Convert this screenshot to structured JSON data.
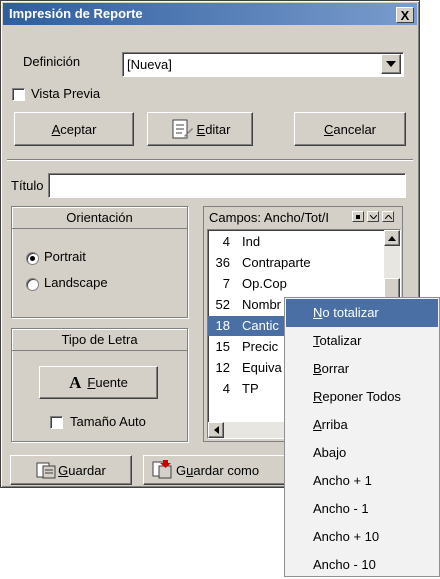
{
  "window": {
    "title": "Impresión de Reporte",
    "close_glyph": "X"
  },
  "definicion": {
    "label": "Definición",
    "value": "[Nueva]"
  },
  "vista_previa": {
    "label": "Vista Previa",
    "checked": false
  },
  "buttons": {
    "aceptar_u": "A",
    "aceptar_rest": "ceptar",
    "editar_u": "E",
    "editar_rest": "ditar",
    "cancelar_u": "C",
    "cancelar_rest": "ancelar",
    "guardar_u": "G",
    "guardar_rest": "uardar",
    "guardar_como_pre": "G",
    "guardar_como_u": "u",
    "guardar_como_rest": "ardar como"
  },
  "titulo": {
    "label": "Título",
    "value": ""
  },
  "orientacion": {
    "title": "Orientación",
    "options": [
      "Portrait",
      "Landscape"
    ],
    "selected": "Portrait"
  },
  "tipo_letra": {
    "title": "Tipo de Letra",
    "fuente_glyph": "A",
    "fuente_u": "F",
    "fuente_rest": "uente",
    "tamano_auto": "Tamaño Auto"
  },
  "campos": {
    "header": "Campos: Ancho/Tot/I",
    "rows": [
      {
        "num": "4",
        "name": "Ind"
      },
      {
        "num": "36",
        "name": "Contraparte"
      },
      {
        "num": "7",
        "name": "Op.Cop"
      },
      {
        "num": "52",
        "name": "Nombr"
      },
      {
        "num": "18",
        "name": "Cantic"
      },
      {
        "num": "15",
        "name": "Precic"
      },
      {
        "num": "12",
        "name": "Equiva"
      },
      {
        "num": "4",
        "name": "TP"
      }
    ],
    "selected_index": 4
  },
  "context_menu": {
    "items": [
      {
        "u": "N",
        "rest": "o totalizar"
      },
      {
        "u": "T",
        "rest": "otalizar"
      },
      {
        "u": "B",
        "rest": "orrar"
      },
      {
        "u": "R",
        "rest": "eponer Todos"
      },
      {
        "u": "A",
        "rest": "rriba"
      },
      {
        "u": "",
        "rest": "Abajo"
      },
      {
        "u": "",
        "rest": "Ancho + 1"
      },
      {
        "u": "",
        "rest": "Ancho - 1"
      },
      {
        "u": "",
        "rest": "Ancho + 10"
      },
      {
        "u": "",
        "rest": "Ancho - 10"
      }
    ],
    "selected_index": 0
  },
  "colors": {
    "title_start": "#2e5e9e",
    "title_end": "#7a9ccd",
    "face": "#d4d0c8",
    "selection": "#4a6fa5"
  }
}
